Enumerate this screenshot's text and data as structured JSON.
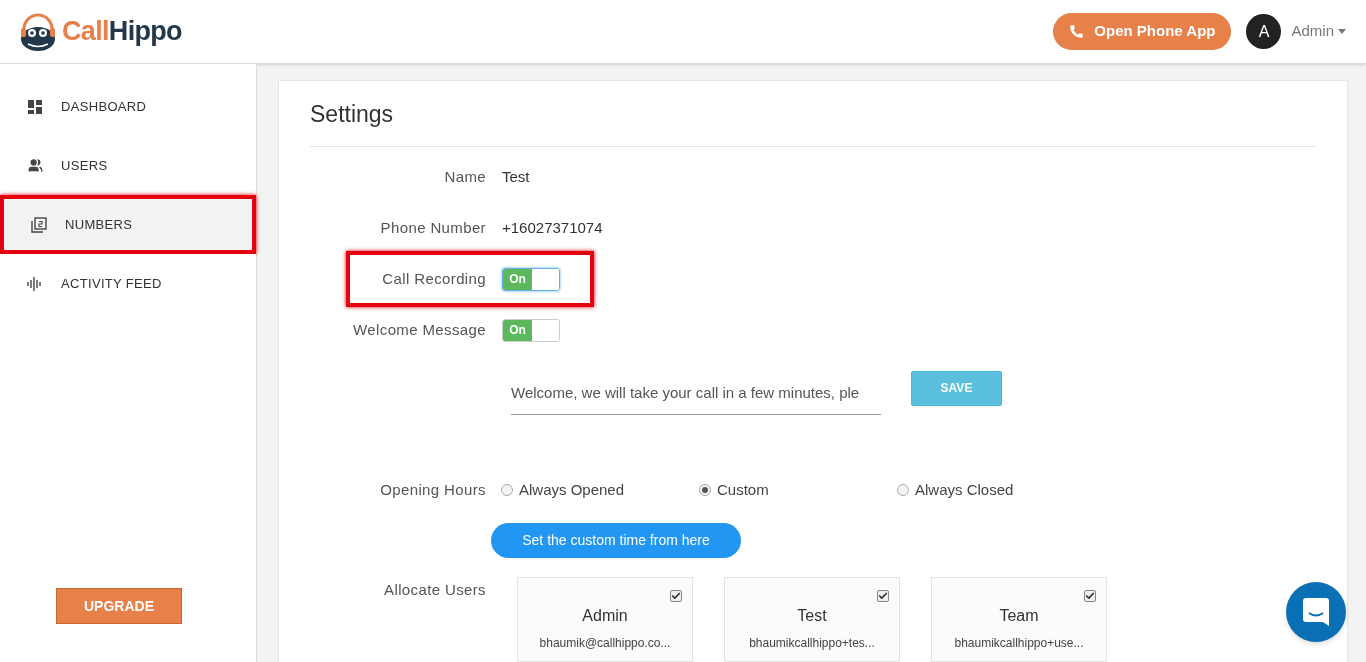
{
  "header": {
    "logo_parts": [
      "Call",
      "Hippo"
    ],
    "phone_button": "Open Phone App",
    "avatar_letter": "A",
    "user_name": "Admin"
  },
  "sidebar": {
    "items": [
      {
        "label": "DASHBOARD",
        "selected": false,
        "highlighted": false
      },
      {
        "label": "USERS",
        "selected": false,
        "highlighted": false
      },
      {
        "label": "NUMBERS",
        "selected": true,
        "highlighted": true
      },
      {
        "label": "ACTIVITY FEED",
        "selected": false,
        "highlighted": false
      }
    ],
    "upgrade_button": "UPGRADE"
  },
  "settings": {
    "title": "Settings",
    "rows": [
      {
        "kind": "text",
        "label": "Name",
        "value": "Test",
        "highlighted": false
      },
      {
        "kind": "text",
        "label": "Phone Number",
        "value": "+16027371074",
        "highlighted": false
      },
      {
        "kind": "toggle",
        "label": "Call Recording",
        "toggle_text": "On",
        "on": true,
        "focused": true,
        "highlighted": true
      },
      {
        "kind": "toggle",
        "label": "Welcome Message",
        "toggle_text": "On",
        "on": true,
        "focused": false,
        "highlighted": false
      }
    ],
    "welcome_field": {
      "value": "Welcome, we will take your call in a few minutes, ple"
    },
    "save_button": "SAVE",
    "opening_hours": {
      "label": "Opening Hours",
      "options": [
        {
          "label": "Always Opened",
          "selected": false
        },
        {
          "label": "Custom",
          "selected": true
        },
        {
          "label": "Always Closed",
          "selected": false
        }
      ],
      "custom_button": "Set the custom time from here"
    },
    "allocate_users": {
      "label": "Allocate Users",
      "users": [
        {
          "name": "Admin",
          "email": "bhaumik@callhippo.co...",
          "checked": true
        },
        {
          "name": "Test",
          "email": "bhaumikcallhippo+tes...",
          "checked": true
        },
        {
          "name": "Team",
          "email": "bhaumikcallhippo+use...",
          "checked": true
        }
      ]
    }
  }
}
